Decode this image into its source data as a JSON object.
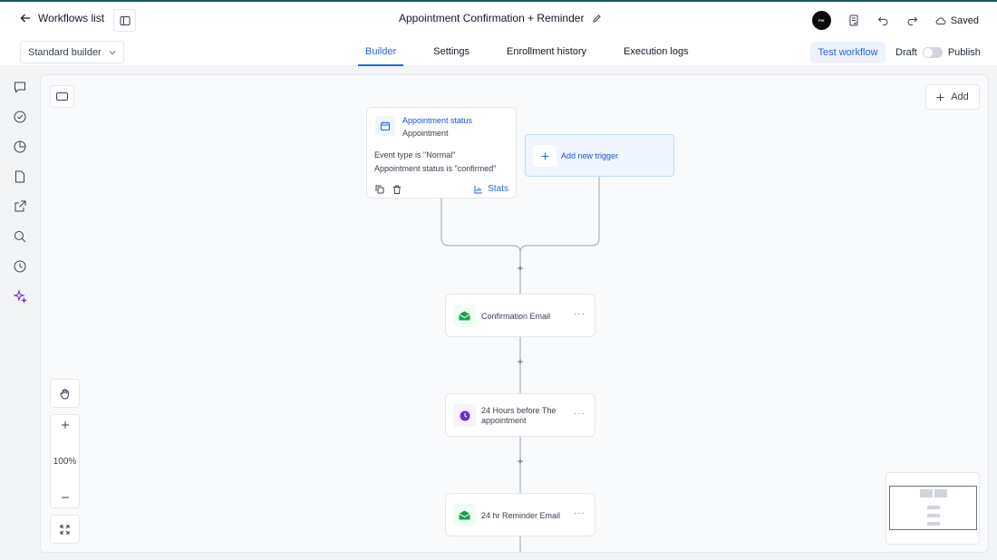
{
  "header": {
    "back_label": "Workflows list",
    "title": "Appointment Confirmation + Reminder",
    "logo_text": "PIXSTRIPE",
    "saved_label": "Saved"
  },
  "toolbar": {
    "builder_select": "Standard builder",
    "tabs": [
      {
        "label": "Builder",
        "active": true
      },
      {
        "label": "Settings",
        "active": false
      },
      {
        "label": "Enrollment history",
        "active": false
      },
      {
        "label": "Execution logs",
        "active": false
      }
    ],
    "test_label": "Test workflow",
    "draft_label": "Draft",
    "publish_label": "Publish"
  },
  "sidebar": {
    "icons": [
      "chat-icon",
      "check-circle-icon",
      "pie-chart-icon",
      "document-icon",
      "external-link-icon",
      "search-icon",
      "history-icon",
      "sparkle-icon"
    ]
  },
  "canvas": {
    "add_label": "Add",
    "zoom_level": "100%",
    "trigger": {
      "title": "Appointment status",
      "subtitle": "Appointment",
      "conditions": [
        "Event type is \"Normal\"",
        "Appointment status is \"confirmed\""
      ],
      "stats_label": "Stats"
    },
    "add_trigger_label": "Add new trigger",
    "nodes": [
      {
        "label": "Confirmation Email",
        "icon": "email-icon",
        "color": "#16a34a"
      },
      {
        "label": "24 Hours before The appointment",
        "icon": "clock-icon",
        "color": "#6d28d9"
      },
      {
        "label": "24 hr Reminder Email",
        "icon": "email-icon",
        "color": "#16a34a"
      }
    ]
  },
  "colors": {
    "accent": "#2563eb",
    "brand_line": "#155e63"
  }
}
